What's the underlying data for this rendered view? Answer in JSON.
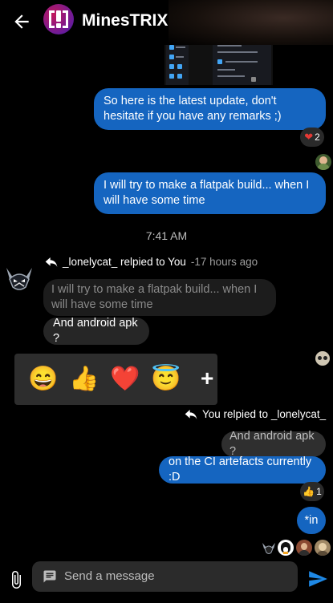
{
  "appbar": {
    "title": "MinesTRIX",
    "back_icon": "arrow-left-icon",
    "logo_icon": "minestrix-logo-icon"
  },
  "messages": {
    "m1": {
      "text": "So here is the latest update, don't hesitate if you have any remarks ;)"
    },
    "m1_reaction": {
      "emoji": "❤",
      "count": "2"
    },
    "m2": {
      "text": "I will try to make a flatpak build... when I will have some time"
    },
    "time_separator": "7:41 AM",
    "reply1": {
      "user_text": "_lonelycat_ relpied to You",
      "separator": " - ",
      "ago": "17 hours ago"
    },
    "reply1_quote": {
      "text": "I will try to make a flatpak build... when I will have some time"
    },
    "reply1_body": {
      "text": "And android apk ?"
    },
    "reply2": {
      "user_text": "You relpied to _lonelycat_"
    },
    "reply2_quote": {
      "text": "And android apk ?"
    },
    "reply2_body": {
      "text": "on the CI artefacts currently :D"
    },
    "reply2_reaction": {
      "emoji": "👍",
      "count": "1"
    },
    "m3": {
      "text": "*in"
    }
  },
  "emoji_picker": {
    "items": [
      "😄",
      "👍",
      "❤️",
      "😇"
    ],
    "more_label": "+"
  },
  "composer": {
    "placeholder": "Send a message",
    "attach_icon": "paperclip-icon",
    "message_icon": "message-icon",
    "send_icon": "send-icon"
  },
  "colors": {
    "outgoing_bubble": "#1565c0",
    "incoming_bubble": "#262626",
    "background": "#000000"
  }
}
